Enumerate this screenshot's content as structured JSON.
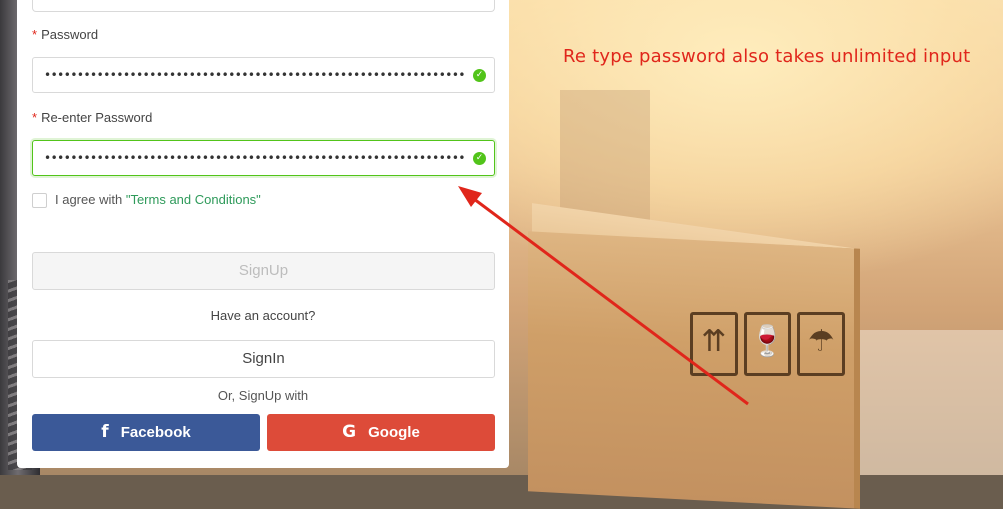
{
  "form": {
    "password": {
      "label": "Password",
      "required_mark": "*",
      "value": "••••••••••••••••••••••••••••••••••••••••••••••••••••••••••••••••••••••••••••••••••",
      "valid_icon": "check-circle-icon"
    },
    "reenter_password": {
      "label": "Re-enter Password",
      "required_mark": "*",
      "value": "••••••••••••••••••••••••••••••••••••••••••••••••••••••••••••••••••••••••••••••••••",
      "valid_icon": "check-circle-icon"
    },
    "agree": {
      "text": "I agree with ",
      "link": "\"Terms and Conditions\""
    },
    "signup_button": "SignUp",
    "have_account": "Have an account?",
    "signin_button": "SignIn",
    "or_signup_with": "Or, SignUp with",
    "facebook_button": "Facebook",
    "facebook_icon": "f",
    "google_button": "Google",
    "google_icon": "G"
  },
  "annotation": {
    "note": "Re type password also takes unlimited input",
    "color": "#e0261b"
  },
  "colors": {
    "valid_green": "#52c41a",
    "facebook_blue": "#3b5998",
    "google_red": "#dd4b39",
    "terms_link": "#2e9a5a"
  }
}
